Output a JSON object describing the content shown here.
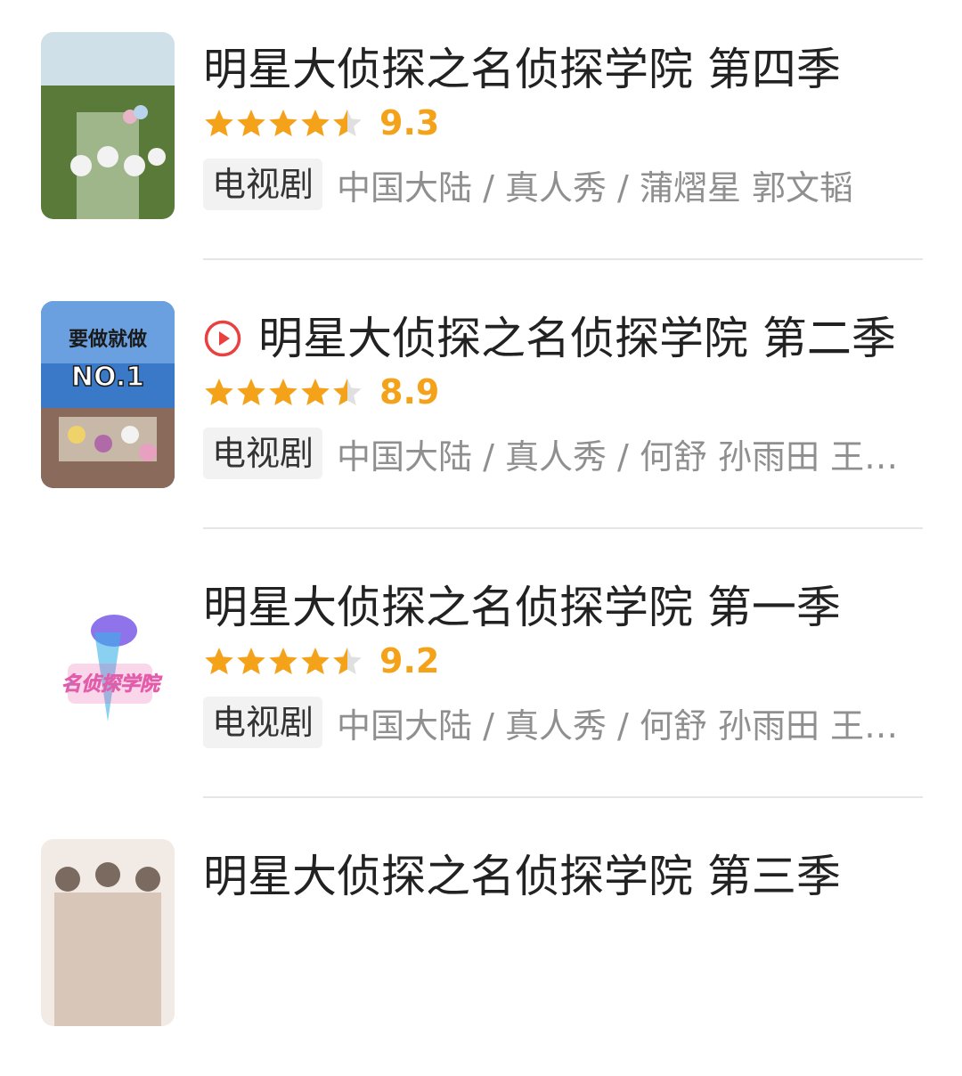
{
  "results": [
    {
      "title": "明星大侦探之名侦探学院 第四季",
      "has_play_icon": false,
      "rating": 9.3,
      "score_text": "9.3",
      "stars_filled": 4.5,
      "type": "电视剧",
      "meta": "中国大陆 / 真人秀 / 蒲熠星 郭文韬",
      "poster_icon": "poster-image",
      "poster_text": "",
      "poster_colors": [
        "#5a7a3a",
        "#9fb58a",
        "#dfe8e0"
      ]
    },
    {
      "title": "明星大侦探之名侦探学院 第二季",
      "has_play_icon": true,
      "rating": 8.9,
      "score_text": "8.9",
      "stars_filled": 4.5,
      "type": "电视剧",
      "meta": "中国大陆 / 真人秀 / 何舒 孙雨田 王以诺",
      "poster_icon": "poster-image",
      "poster_text": "要做就做NO.1",
      "poster_colors": [
        "#3a78c8",
        "#f0d26a",
        "#b06aa8"
      ]
    },
    {
      "title": "明星大侦探之名侦探学院 第一季",
      "has_play_icon": false,
      "rating": 9.2,
      "score_text": "9.2",
      "stars_filled": 4.5,
      "type": "电视剧",
      "meta": "中国大陆 / 真人秀 / 何舒 孙雨田 王以诺",
      "poster_icon": "poster-logo",
      "poster_text": "名侦探学院",
      "poster_colors": [
        "#3ab0e8",
        "#e85aa8",
        "#7a5ae8"
      ]
    },
    {
      "title": "明星大侦探之名侦探学院 第三季",
      "has_play_icon": false,
      "rating": null,
      "score_text": "",
      "stars_filled": 0,
      "type": "",
      "meta": "",
      "poster_icon": "poster-image",
      "poster_text": "",
      "poster_colors": [
        "#d8c6b8",
        "#7a6a60",
        "#f2ebe5"
      ]
    }
  ],
  "colors": {
    "star": "#f4a21a",
    "star_empty": "#e0e0e0",
    "play_icon": "#e8413f",
    "divider": "#e6e6e6"
  }
}
